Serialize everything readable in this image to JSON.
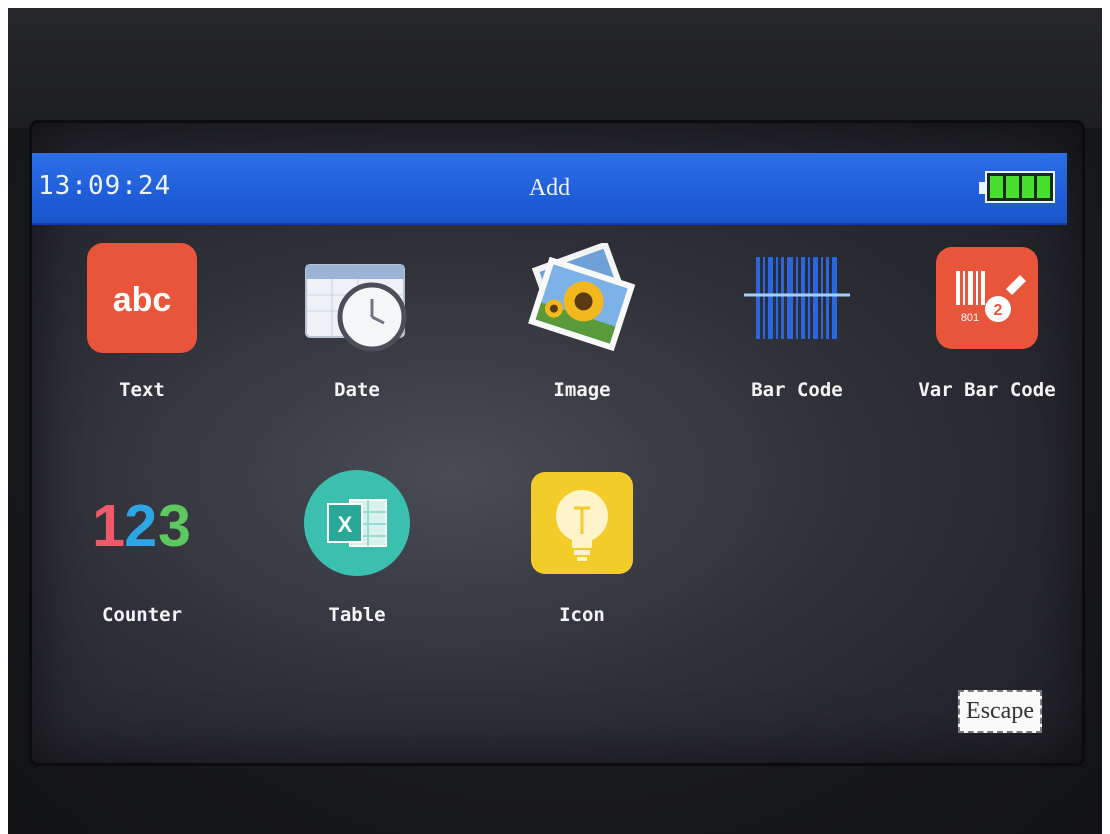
{
  "statusbar": {
    "time": "13:09:24",
    "title": "Add",
    "battery_level": 1.0
  },
  "items": [
    {
      "label": "Text",
      "icon": "abc-text-icon"
    },
    {
      "label": "Date",
      "icon": "calendar-clock-icon"
    },
    {
      "label": "Image",
      "icon": "sunflower-photo-icon"
    },
    {
      "label": "Bar Code",
      "icon": "barcode-icon"
    },
    {
      "label": "Var Bar Code",
      "icon": "variable-barcode-icon"
    },
    {
      "label": "Counter",
      "icon": "counter-123-icon"
    },
    {
      "label": "Table",
      "icon": "spreadsheet-icon"
    },
    {
      "label": "Icon",
      "icon": "lightbulb-icon"
    }
  ],
  "icon_text": {
    "abc": "abc",
    "counter_1": "1",
    "counter_2": "2",
    "counter_3": "3",
    "table_x": "X",
    "var_barcode_num": "801",
    "var_barcode_badge": "2"
  },
  "escape_label": "Escape",
  "colors": {
    "statusbar": "#1f5ed8",
    "text_icon_bg": "#e8553a",
    "var_barcode_bg": "#e8553a",
    "table_icon_bg": "#3bbfae",
    "icon_icon_bg": "#f2cd2a",
    "battery_fill": "#47e02f"
  }
}
